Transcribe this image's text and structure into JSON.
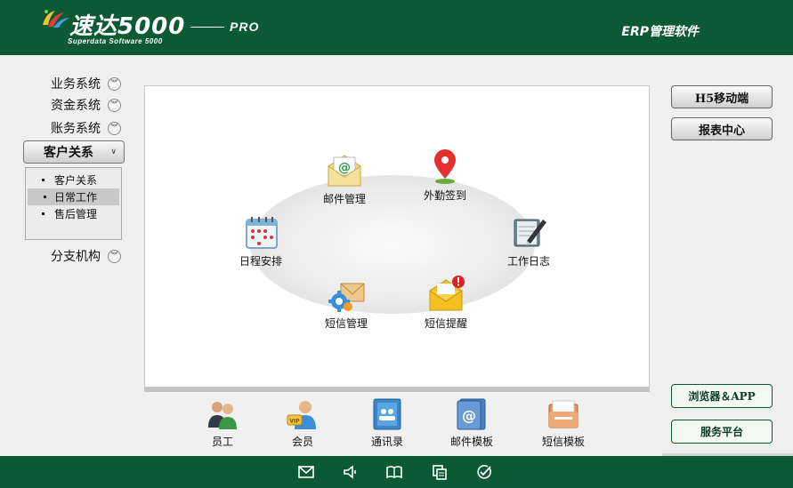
{
  "header": {
    "brand_title": "速达5000",
    "brand_subtitle": "Superdata Software 5000",
    "edition": "PRO",
    "product_name": "ERP管理软件"
  },
  "nav": {
    "items": [
      {
        "label": "业务系统"
      },
      {
        "label": "资金系统"
      },
      {
        "label": "账务系统"
      },
      {
        "label": "客户关系"
      },
      {
        "label": "分支机构"
      }
    ],
    "active_index": 3,
    "submenu": [
      {
        "label": "客户关系"
      },
      {
        "label": "日常工作"
      },
      {
        "label": "售后管理"
      }
    ],
    "submenu_selected_index": 1
  },
  "main": {
    "functions": [
      {
        "label": "邮件管理",
        "icon": "email-envelope-icon"
      },
      {
        "label": "外勤签到",
        "icon": "map-pin-icon"
      },
      {
        "label": "日程安排",
        "icon": "calendar-icon"
      },
      {
        "label": "工作日志",
        "icon": "notebook-pen-icon"
      },
      {
        "label": "短信管理",
        "icon": "sms-gear-icon"
      },
      {
        "label": "短信提醒",
        "icon": "sms-alert-icon"
      }
    ],
    "bottom_functions": [
      {
        "label": "员工",
        "icon": "employees-icon"
      },
      {
        "label": "会员",
        "icon": "vip-member-icon"
      },
      {
        "label": "通讯录",
        "icon": "address-book-icon"
      },
      {
        "label": "邮件模板",
        "icon": "email-template-icon"
      },
      {
        "label": "短信模板",
        "icon": "sms-template-icon"
      }
    ]
  },
  "right": {
    "buttons": [
      {
        "label": "H5移动端"
      },
      {
        "label": "报表中心"
      }
    ],
    "green_buttons": [
      {
        "label": "浏览器＆APP"
      },
      {
        "label": "服务平台"
      }
    ]
  },
  "footer": {
    "icons": [
      "mail-icon",
      "speaker-icon",
      "book-icon",
      "copy-icon",
      "check-circle-icon"
    ]
  },
  "colors": {
    "brand_green": "#0b5a34",
    "background": "#efefef",
    "panel": "#ffffff"
  }
}
